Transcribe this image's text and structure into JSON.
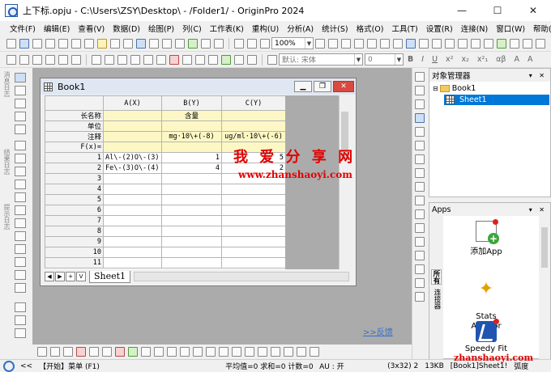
{
  "titlebar": {
    "title": "上下标.opju - C:\\Users\\ZSY\\Desktop\\ - /Folder1/ - OriginPro 2024",
    "minimize": "—",
    "maximize": "☐",
    "close": "✕"
  },
  "menu": [
    "文件(F)",
    "编辑(E)",
    "查看(V)",
    "数据(D)",
    "绘图(P)",
    "列(C)",
    "工作表(K)",
    "重构(U)",
    "分析(A)",
    "统计(S)",
    "格式(O)",
    "工具(T)",
    "设置(R)",
    "连接(N)",
    "窗口(W)",
    "帮助(H)"
  ],
  "toolbar": {
    "zoom": "100%",
    "font": "默认: 宋体",
    "size": "0",
    "fmt_bold": "B",
    "fmt_italic": "I",
    "fmt_underline": "U",
    "fmt_super": "x²",
    "fmt_sub": "x₂",
    "fmt_supsub": "x²₁",
    "fmt_greek": "αβ",
    "fmt_a1": "A",
    "fmt_a2": "A"
  },
  "left_panel_tabs": [
    "消息日志",
    "结果日志",
    "提示日志"
  ],
  "book": {
    "title": "Book1",
    "columns": [
      "A(X)",
      "B(Y)",
      "C(Y)"
    ],
    "meta_rows": [
      {
        "label": "长名称",
        "a": "",
        "b": "含量",
        "c": ""
      },
      {
        "label": "单位",
        "a": "",
        "b": "",
        "c": ""
      },
      {
        "label": "注释",
        "a": "",
        "b": "mg·10\\+(-8)",
        "c": "ug/ml·10\\+(-6)"
      },
      {
        "label": "F(x)=",
        "a": "",
        "b": "",
        "c": ""
      }
    ],
    "data_rows": [
      {
        "n": "1",
        "a": "Al\\-(2)O\\-(3)",
        "b": "1",
        "c": "5"
      },
      {
        "n": "2",
        "a": "Fe\\-(3)O\\-(4)",
        "b": "4",
        "c": "2"
      },
      {
        "n": "3",
        "a": "",
        "b": "",
        "c": ""
      },
      {
        "n": "4",
        "a": "",
        "b": "",
        "c": ""
      },
      {
        "n": "5",
        "a": "",
        "b": "",
        "c": ""
      },
      {
        "n": "6",
        "a": "",
        "b": "",
        "c": ""
      },
      {
        "n": "7",
        "a": "",
        "b": "",
        "c": ""
      },
      {
        "n": "8",
        "a": "",
        "b": "",
        "c": ""
      },
      {
        "n": "9",
        "a": "",
        "b": "",
        "c": ""
      },
      {
        "n": "10",
        "a": "",
        "b": "",
        "c": ""
      },
      {
        "n": "11",
        "a": "",
        "b": "",
        "c": ""
      }
    ],
    "sheet_tab": "Sheet1",
    "nav": [
      "◀",
      "▶",
      "+",
      "V"
    ]
  },
  "watermark": {
    "cn": "我 爱 分 享 网",
    "url": "www.zhanshaoyi.com",
    "url2": "zhanshaoyi.com"
  },
  "feedback": ">>反馈",
  "object_manager": {
    "title": "对象管理器",
    "ctrls": "▾ ✕",
    "book": "Book1",
    "sheet": "Sheet1"
  },
  "apps": {
    "title": "Apps",
    "ctrls": "▾ ✕",
    "tabs": [
      "所有",
      "连接器"
    ],
    "items": [
      {
        "label": "添加App"
      },
      {
        "label": "Stats\nAdvisor"
      },
      {
        "label": "Speedy Fit"
      }
    ]
  },
  "status": {
    "arrows": "<<",
    "start": "【开始】菜单 (F1)",
    "stats": "平均值=0 求和=0 计数=0",
    "au": "AU : 开",
    "cell": "(3x32) 2",
    "size": "13KB",
    "sheet": "[Book1]Sheet1!",
    "unit": "弧度"
  },
  "colors": {
    "accent": "#0078d7",
    "meta_bg": "#fcf7c5",
    "watermark": "#e10000",
    "workspace": "#ababab"
  }
}
